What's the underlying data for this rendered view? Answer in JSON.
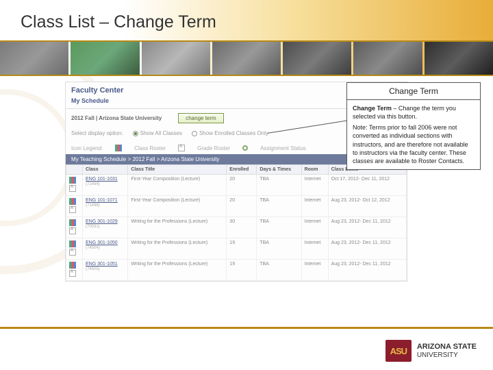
{
  "slide": {
    "title": "Class List – Change Term"
  },
  "callout": {
    "title": "Change Term",
    "bold_lead": "Change Term",
    "body1": " – Change the term you selected via this button.",
    "body2": "Note:  Terms prior to fall 2006 were not converted as individual sections with instructors, and are therefore not available to instructors via the faculty center.  These classes are available to Roster Contacts."
  },
  "fc": {
    "header": "Faculty Center",
    "subheader": "My Schedule",
    "term_line": "2012 Fall | Arizona State University",
    "change_btn": "change term",
    "display_label": "Select display option:",
    "opt_all": "Show All Classes",
    "opt_enrolled": "Show Enrolled Classes Only",
    "legend_label": "Icon Legend:",
    "legend_roster": "Class Roster",
    "legend_grade": "Grade Roster",
    "legend_status": "Assignment Status",
    "table_title": "My Teaching Schedule > 2012 Fall > Arizona State University"
  },
  "cols": {
    "c0": "",
    "c1": "Class",
    "c2": "Class Title",
    "c3": "Enrolled",
    "c4": "Days & Times",
    "c5": "Room",
    "c6": "Class Dates"
  },
  "rows": [
    {
      "cls": "ENG 101-1031",
      "id": "(71484)",
      "title": "First-Year Composition (Lecture)",
      "enr": "20",
      "dt": "TBA",
      "room": "Internet",
      "dates": "Oct 17, 2012- Dec 11, 2012"
    },
    {
      "cls": "ENG 101-1071",
      "id": "(71498)",
      "title": "First-Year Composition (Lecture)",
      "enr": "20",
      "dt": "TBA",
      "room": "Internet",
      "dates": "Aug 23, 2012- Oct 12, 2012"
    },
    {
      "cls": "ENG 301-1029",
      "id": "(70031)",
      "title": "Writing for the Professions (Lecture)",
      "enr": "30",
      "dt": "TBA",
      "room": "Internet",
      "dates": "Aug 23, 2012- Dec 11, 2012"
    },
    {
      "cls": "ENG 301-1050",
      "id": "(74504)",
      "title": "Writing for the Professions (Lecture)",
      "enr": "19",
      "dt": "TBA",
      "room": "Internet",
      "dates": "Aug 23, 2012- Dec 11, 2012"
    },
    {
      "cls": "ENG 301-1051",
      "id": "(74505)",
      "title": "Writing for the Professions (Lecture)",
      "enr": "19",
      "dt": "TBA",
      "room": "Internet",
      "dates": "Aug 23, 2012- Dec 11, 2012"
    }
  ],
  "logo": {
    "mark": "ASU",
    "line1": "ARIZONA STATE",
    "line2": "UNIVERSITY"
  }
}
